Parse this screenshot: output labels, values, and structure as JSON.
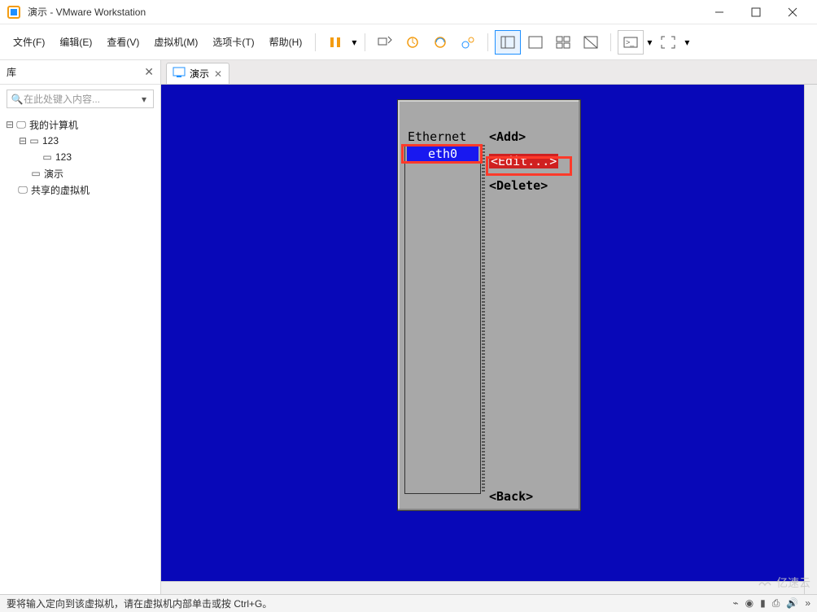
{
  "window": {
    "title": "演示 - VMware Workstation"
  },
  "menu": {
    "file": "文件(F)",
    "edit": "编辑(E)",
    "view": "查看(V)",
    "vm": "虚拟机(M)",
    "tabs": "选项卡(T)",
    "help": "帮助(H)"
  },
  "sidebar": {
    "title": "库",
    "search_placeholder": "在此处键入内容...",
    "tree": {
      "root": "我的计算机",
      "node1": "123",
      "node1_child": "123",
      "node2": "演示",
      "shared": "共享的虚拟机"
    }
  },
  "tab": {
    "label": "演示"
  },
  "tui": {
    "section": "Ethernet",
    "iface": "eth0",
    "add": "<Add>",
    "edit": "<Edit...>",
    "delete": "<Delete>",
    "back": "<Back>"
  },
  "statusbar": {
    "text": "要将输入定向到该虚拟机，请在虚拟机内部单击或按 Ctrl+G。"
  },
  "watermark": "亿速云"
}
